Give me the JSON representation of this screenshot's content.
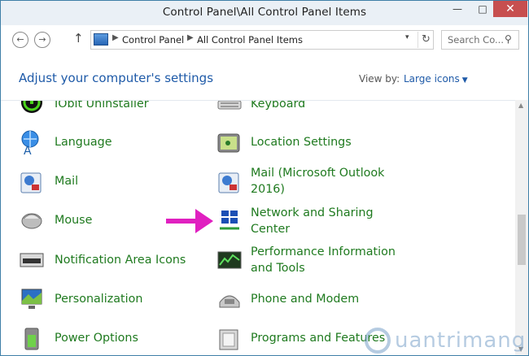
{
  "window": {
    "title": "Control Panel\\All Control Panel Items",
    "minimize": "—",
    "maximize": "□",
    "close": "✕"
  },
  "nav": {
    "back": "←",
    "forward": "→",
    "up": "↑",
    "sep": "▶",
    "dropdown": "▾",
    "refresh": "↻"
  },
  "address": {
    "segments": [
      "Control Panel",
      "All Control Panel Items"
    ]
  },
  "search": {
    "placeholder": "Search Co...",
    "icon": "⚲"
  },
  "header": {
    "title": "Adjust your computer's settings",
    "view_by_label": "View by:",
    "view_mode": "Large icons",
    "dropdown": "▼"
  },
  "items": {
    "iobit": "IObit Uninstaller",
    "keyboard": "Keyboard",
    "language": "Language",
    "location": "Location Settings",
    "mail": "Mail",
    "mail_outlook_1": "Mail (Microsoft Outlook",
    "mail_outlook_2": "2016)",
    "mouse": "Mouse",
    "network_1": "Network and Sharing",
    "network_2": "Center",
    "notification": "Notification Area Icons",
    "performance_1": "Performance Information",
    "performance_2": "and Tools",
    "personalization": "Personalization",
    "phone": "Phone and Modem",
    "power": "Power Options",
    "programs": "Programs and Features"
  },
  "scrollbar": {
    "up": "▲",
    "down": "▼"
  },
  "watermark": {
    "text": "uantrimang"
  },
  "colors": {
    "link_green": "#1f7a1f",
    "heading_blue": "#1e5aa8",
    "annotation_arrow": "#e020c0",
    "close_red": "#c74f4f"
  }
}
